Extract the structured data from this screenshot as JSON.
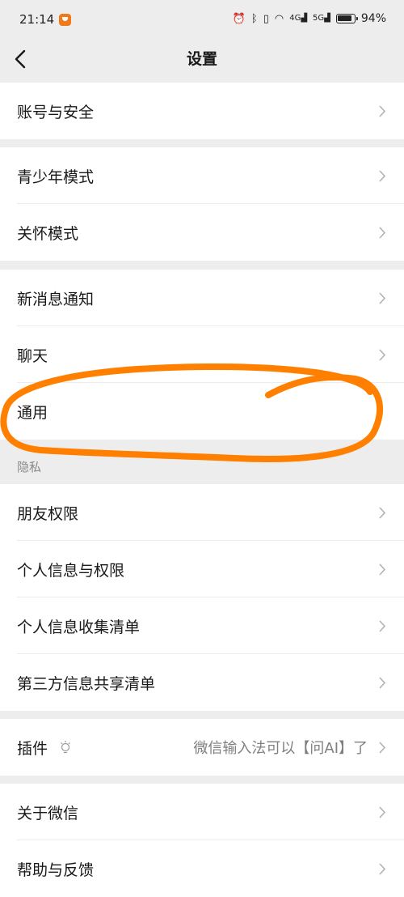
{
  "status_bar": {
    "time": "21:14",
    "battery": "94%",
    "net_a": "4G",
    "net_b": "5G"
  },
  "nav": {
    "title": "设置"
  },
  "groups": [
    {
      "items": [
        {
          "label": "账号与安全"
        }
      ]
    },
    {
      "items": [
        {
          "label": "青少年模式"
        },
        {
          "label": "关怀模式"
        }
      ]
    },
    {
      "items": [
        {
          "label": "新消息通知"
        },
        {
          "label": "聊天"
        },
        {
          "label": "通用"
        }
      ]
    },
    {
      "section_label": "隐私",
      "items": [
        {
          "label": "朋友权限"
        },
        {
          "label": "个人信息与权限"
        },
        {
          "label": "个人信息收集清单"
        },
        {
          "label": "第三方信息共享清单"
        }
      ]
    },
    {
      "items": [
        {
          "label": "插件",
          "subtitle": "微信输入法可以【问AI】了"
        }
      ]
    },
    {
      "items": [
        {
          "label": "关于微信"
        },
        {
          "label": "帮助与反馈"
        }
      ]
    }
  ],
  "colors": {
    "background": "#ededed",
    "annotation": "#ff7f00",
    "app_badge": "#f07a1a"
  }
}
